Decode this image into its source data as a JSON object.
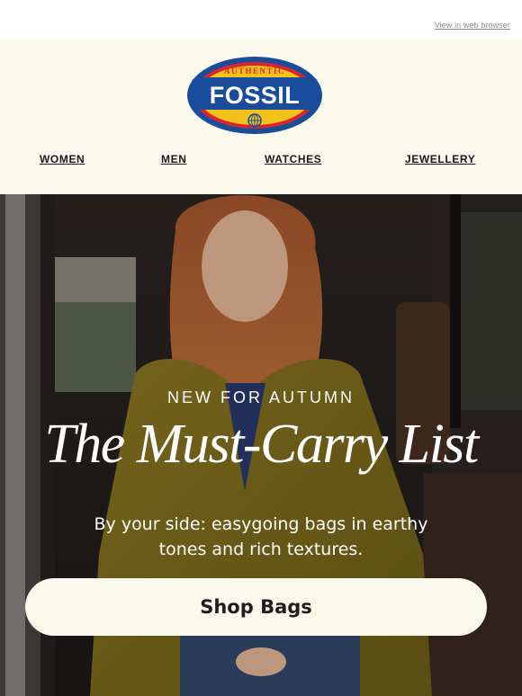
{
  "topbar": {
    "view_link": "View in web browser"
  },
  "logo": {
    "top_text": "AUTHENTIC",
    "brand": "FOSSIL"
  },
  "nav": {
    "items": [
      {
        "label": "WOMEN"
      },
      {
        "label": "MEN"
      },
      {
        "label": "WATCHES"
      },
      {
        "label": "JEWELLERY"
      }
    ]
  },
  "hero": {
    "eyebrow": "NEW FOR AUTUMN",
    "headline": "The Must-Carry List",
    "subtext_line1": "By your side: easygoing bags in earthy",
    "subtext_line2": "tones and rich textures.",
    "cta_label": "Shop Bags"
  },
  "colors": {
    "header_bg": "#fbf8ec",
    "logo_blue": "#1a4c9c",
    "logo_red": "#d9262a",
    "logo_yellow": "#f4c21c",
    "cta_bg": "#fbf8ec"
  }
}
